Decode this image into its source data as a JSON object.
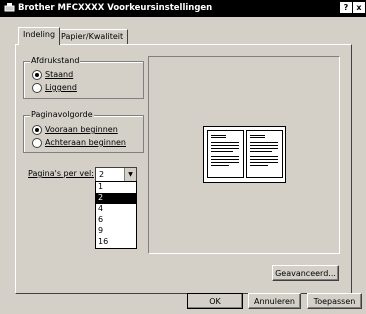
{
  "window": {
    "title": "Brother MFCXXXX Voorkeursinstellingen",
    "help_btn": "?",
    "close_btn": "x"
  },
  "tabs": [
    {
      "label": "Indeling"
    },
    {
      "label": "Papier/Kwaliteit"
    }
  ],
  "orientation": {
    "label": "Afdrukstand",
    "portrait": {
      "label": "Staand",
      "checked": true
    },
    "landscape": {
      "label": "Liggend",
      "checked": false
    }
  },
  "page_order": {
    "label": "Paginavolgorde",
    "front_to_back": {
      "label": "Vooraan beginnen",
      "checked": true
    },
    "back_to_front": {
      "label": "Achteraan beginnen",
      "checked": false
    }
  },
  "pages_per_sheet": {
    "label": "Pagina's per vel:",
    "value": "2",
    "options": [
      "1",
      "2",
      "4",
      "6",
      "9",
      "16"
    ]
  },
  "buttons": {
    "advanced": "Geavanceerd...",
    "ok": "OK",
    "cancel": "Annuleren",
    "apply": "Toepassen"
  }
}
